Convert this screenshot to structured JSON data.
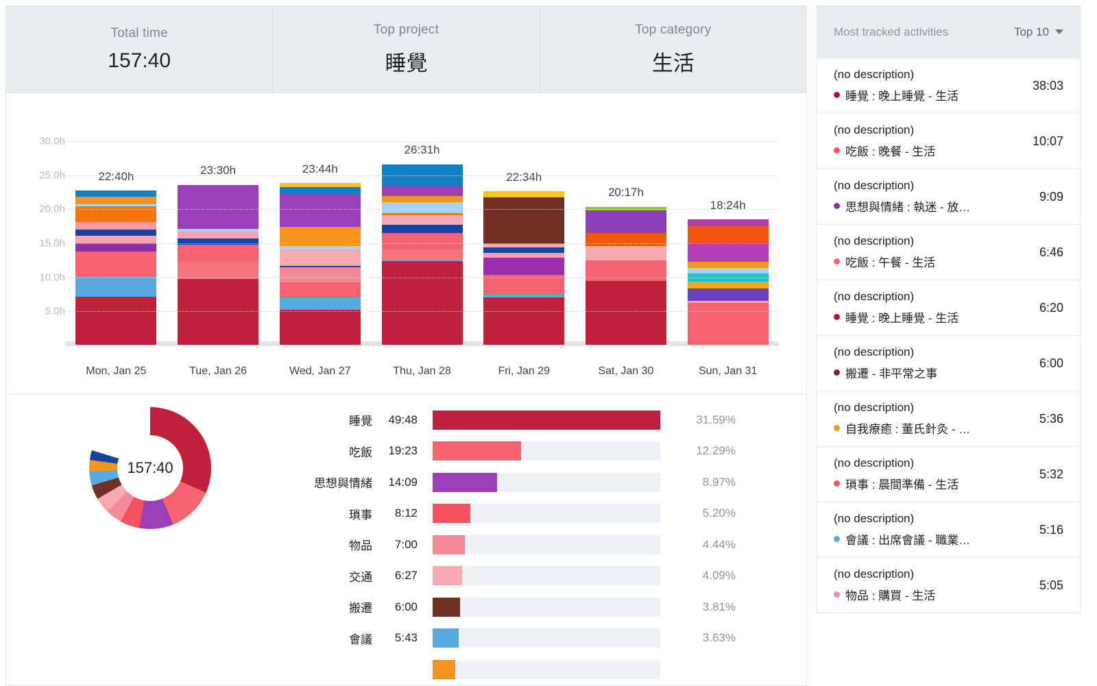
{
  "summary": {
    "cards": [
      {
        "label": "Total time",
        "value": "157:40"
      },
      {
        "label": "Top project",
        "value": "睡覺"
      },
      {
        "label": "Top category",
        "value": "生活"
      }
    ]
  },
  "chart_data": {
    "type": "bar",
    "title": "",
    "xlabel": "",
    "ylabel": "",
    "stacked": true,
    "grid": true,
    "ylim": [
      0,
      32
    ],
    "ytick_labels": [
      "5.0h",
      "10.0h",
      "15.0h",
      "20.0h",
      "25.0h",
      "30.0h"
    ],
    "ytick_values": [
      5,
      10,
      15,
      20,
      25,
      30
    ],
    "categories": [
      "Mon, Jan 25",
      "Tue, Jan 26",
      "Wed, Jan 27",
      "Thu, Jan 28",
      "Fri, Jan 29",
      "Sat, Jan 30",
      "Sun, Jan 31"
    ],
    "totals_labels": [
      "22:40h",
      "23:30h",
      "23:44h",
      "26:31h",
      "22:34h",
      "20:17h",
      "18:24h"
    ],
    "totals": [
      22.67,
      23.5,
      23.73,
      26.52,
      22.57,
      20.28,
      18.4
    ],
    "bars": [
      {
        "category": "Mon, Jan 25",
        "total": 22.67,
        "segments": [
          {
            "value": 6.7,
            "color": "#c0213a"
          },
          {
            "value": 2.9,
            "color": "#5aaae0"
          },
          {
            "value": 3.5,
            "color": "#f5646e"
          },
          {
            "value": 1.2,
            "color": "#8e2fa8"
          },
          {
            "value": 1.0,
            "color": "#f5a3ae"
          },
          {
            "value": 0.85,
            "color": "#1446a0"
          },
          {
            "value": 1.1,
            "color": "#f59aa8"
          },
          {
            "value": 2.2,
            "color": "#f3750e"
          },
          {
            "value": 0.35,
            "color": "#a8d3f0"
          },
          {
            "value": 1.0,
            "color": "#f6911e"
          },
          {
            "value": 0.9,
            "color": "#1380c4"
          }
        ]
      },
      {
        "category": "Tue, Jan 26",
        "total": 23.5,
        "segments": [
          {
            "value": 9.6,
            "color": "#c0213a"
          },
          {
            "value": 2.6,
            "color": "#f5747e"
          },
          {
            "value": 2.5,
            "color": "#f5646e"
          },
          {
            "value": 0.85,
            "color": "#1446a0"
          },
          {
            "value": 1.0,
            "color": "#f5a3ae"
          },
          {
            "value": 0.4,
            "color": "#a8d3f0"
          },
          {
            "value": 6.5,
            "color": "#9b3fb8"
          }
        ]
      },
      {
        "category": "Wed, Jan 27",
        "total": 23.73,
        "segments": [
          {
            "value": 4.8,
            "color": "#c0213a"
          },
          {
            "value": 1.8,
            "color": "#5aaae0"
          },
          {
            "value": 2.0,
            "color": "#f5646e"
          },
          {
            "value": 2.1,
            "color": "#f18994"
          },
          {
            "value": 0.25,
            "color": "#1446a0"
          },
          {
            "value": 2.3,
            "color": "#f7a9b4"
          },
          {
            "value": 0.45,
            "color": "#a8d3f0"
          },
          {
            "value": 2.6,
            "color": "#f5941f"
          },
          {
            "value": 4.5,
            "color": "#9b3fb8"
          },
          {
            "value": 1.1,
            "color": "#1380c4"
          },
          {
            "value": 0.5,
            "color": "#f5c518"
          }
        ]
      },
      {
        "category": "Thu, Jan 28",
        "total": 26.52,
        "segments": [
          {
            "value": 12.2,
            "color": "#c0213a"
          },
          {
            "value": 0.25,
            "color": "#5aaae0"
          },
          {
            "value": 1.5,
            "color": "#f5747e"
          },
          {
            "value": 2.4,
            "color": "#f5646e"
          },
          {
            "value": 1.2,
            "color": "#1446a0"
          },
          {
            "value": 1.4,
            "color": "#f7a9b4"
          },
          {
            "value": 0.3,
            "color": "#f3750e"
          },
          {
            "value": 1.6,
            "color": "#a8d3f0"
          },
          {
            "value": 0.9,
            "color": "#f5941f"
          },
          {
            "value": 1.4,
            "color": "#9b3fb8"
          },
          {
            "value": 3.3,
            "color": "#1380c4"
          }
        ]
      },
      {
        "category": "Fri, Jan 29",
        "total": 22.57,
        "segments": [
          {
            "value": 7.0,
            "color": "#c0213a"
          },
          {
            "value": 0.35,
            "color": "#2fc5d6"
          },
          {
            "value": 2.9,
            "color": "#f5646e"
          },
          {
            "value": 2.6,
            "color": "#9b2fb0"
          },
          {
            "value": 0.7,
            "color": "#f5a3ae"
          },
          {
            "value": 0.75,
            "color": "#1446a0"
          },
          {
            "value": 0.5,
            "color": "#f7a9b4"
          },
          {
            "value": 6.9,
            "color": "#703023"
          },
          {
            "value": 0.9,
            "color": "#f5c518"
          }
        ]
      },
      {
        "category": "Sat, Jan 30",
        "total": 20.28,
        "segments": [
          {
            "value": 9.3,
            "color": "#c0213a"
          },
          {
            "value": 3.0,
            "color": "#f5646e"
          },
          {
            "value": 2.1,
            "color": "#f7a9b4"
          },
          {
            "value": 1.9,
            "color": "#f3590e"
          },
          {
            "value": 3.3,
            "color": "#8e3fb8"
          },
          {
            "value": 0.6,
            "color": "#8cc63f"
          }
        ]
      },
      {
        "category": "Sun, Jan 31",
        "total": 18.4,
        "segments": [
          {
            "value": 6.0,
            "color": "#f5646e"
          },
          {
            "value": 0.3,
            "color": "#f5a3ae"
          },
          {
            "value": 1.8,
            "color": "#6b3fc0"
          },
          {
            "value": 1.0,
            "color": "#f5a723"
          },
          {
            "value": 1.1,
            "color": "#21c5c8"
          },
          {
            "value": 0.8,
            "color": "#a8d3f0"
          },
          {
            "value": 0.9,
            "color": "#f5941f"
          },
          {
            "value": 2.7,
            "color": "#b03fb8"
          },
          {
            "value": 2.4,
            "color": "#f3550e"
          },
          {
            "value": 1.0,
            "color": "#b03fa8"
          }
        ]
      }
    ]
  },
  "breakdown": {
    "donut_center": "157:40",
    "donut_slices": [
      {
        "label": "睡覺",
        "pct": 31.59,
        "color": "#c0213a"
      },
      {
        "label": "吃飯",
        "pct": 12.29,
        "color": "#f5646e"
      },
      {
        "label": "思想與情緒",
        "pct": 8.97,
        "color": "#9b3fb8"
      },
      {
        "label": "瑣事",
        "pct": 5.2,
        "color": "#f5515f"
      },
      {
        "label": "物品",
        "pct": 4.44,
        "color": "#f28a98"
      },
      {
        "label": "交通",
        "pct": 4.09,
        "color": "#f7a9b4"
      },
      {
        "label": "搬遷",
        "pct": 3.81,
        "color": "#703023"
      },
      {
        "label": "會議",
        "pct": 3.63,
        "color": "#5aaae0"
      },
      {
        "label": "",
        "pct": 3.1,
        "color": "#f5941f"
      },
      {
        "label": "",
        "pct": 2.6,
        "color": "#1446a0"
      },
      {
        "label": "",
        "pct": 20.28,
        "color": "#ffffff"
      }
    ],
    "categories": [
      {
        "name": "睡覺",
        "time": "49:48",
        "pct_label": "31.59%",
        "pct": 31.59,
        "color": "#c0213a"
      },
      {
        "name": "吃飯",
        "time": "19:23",
        "pct_label": "12.29%",
        "pct": 12.29,
        "color": "#f5646e"
      },
      {
        "name": "思想與情緒",
        "time": "14:09",
        "pct_label": "8.97%",
        "pct": 8.97,
        "color": "#9b3fb8"
      },
      {
        "name": "瑣事",
        "time": "8:12",
        "pct_label": "5.20%",
        "pct": 5.2,
        "color": "#f5515f"
      },
      {
        "name": "物品",
        "time": "7:00",
        "pct_label": "4.44%",
        "pct": 4.44,
        "color": "#f28a98"
      },
      {
        "name": "交通",
        "time": "6:27",
        "pct_label": "4.09%",
        "pct": 4.09,
        "color": "#f7a9b4"
      },
      {
        "name": "搬遷",
        "time": "6:00",
        "pct_label": "3.81%",
        "pct": 3.81,
        "color": "#703023"
      },
      {
        "name": "會議",
        "time": "5:43",
        "pct_label": "3.63%",
        "pct": 3.63,
        "color": "#5aaae0"
      },
      {
        "name": "",
        "time": "",
        "pct_label": "",
        "pct": 3.1,
        "color": "#f5941f"
      }
    ]
  },
  "sidebar": {
    "title": "Most tracked activities",
    "top_label": "Top 10",
    "caret_icon": "chevron-down-icon",
    "activities": [
      {
        "description": "(no description)",
        "project": "睡覺 : 晚上睡覺 - 生活",
        "time": "38:03",
        "color": "#b0152f"
      },
      {
        "description": "(no description)",
        "project": "吃飯 : 晚餐 - 生活",
        "time": "10:07",
        "color": "#f5535f"
      },
      {
        "description": "(no description)",
        "project": "思想與情緒 : 執迷 - 放…",
        "time": "9:09",
        "color": "#8e2fa8"
      },
      {
        "description": "(no description)",
        "project": "吃飯 : 午餐 - 生活",
        "time": "6:46",
        "color": "#f5646e"
      },
      {
        "description": "(no description)",
        "project": "睡覺 : 晚上睡覺 - 生活",
        "time": "6:20",
        "color": "#b0152f"
      },
      {
        "description": "(no description)",
        "project": "搬遷 - 非平常之事",
        "time": "6:00",
        "color": "#703023"
      },
      {
        "description": "(no description)",
        "project": "自我療癒 : 董氏針灸 - …",
        "time": "5:36",
        "color": "#f5941f"
      },
      {
        "description": "(no description)",
        "project": "瑣事 : 晨間準備 - 生活",
        "time": "5:32",
        "color": "#f5515f"
      },
      {
        "description": "(no description)",
        "project": "會議 : 出席會議 - 職業…",
        "time": "5:16",
        "color": "#5aaae0"
      },
      {
        "description": "(no description)",
        "project": "物品 : 購買 - 生活",
        "time": "5:05",
        "color": "#f28a98"
      }
    ]
  }
}
